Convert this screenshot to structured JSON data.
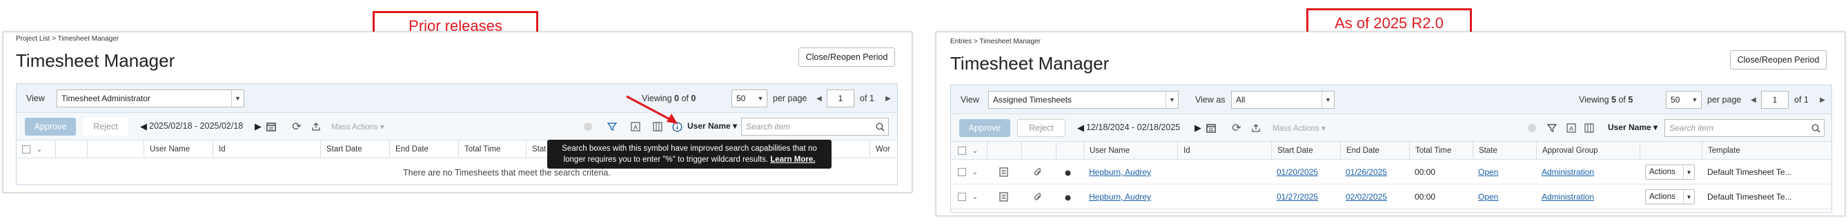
{
  "callouts": {
    "prior": "Prior releases",
    "current": "As of 2025 R2.0"
  },
  "left": {
    "breadcrumb": "Project List > Timesheet Manager",
    "title": "Timesheet Manager",
    "close_reopen": "Close/Reopen Period",
    "view_label": "View",
    "view_value": "Timesheet Administrator",
    "viewing_prefix": "Viewing",
    "viewing_count": "0",
    "viewing_of": "of",
    "viewing_total": "0",
    "per_page_value": "50",
    "per_page_label": "per page",
    "page_value": "1",
    "page_of": "of 1",
    "approve": "Approve",
    "reject": "Reject",
    "date_range": "2025/02/18 - 2025/02/18",
    "mass_actions": "Mass Actions",
    "search_field": "User Name",
    "search_placeholder": "Search item",
    "columns": [
      "User Name",
      "Id",
      "Start Date",
      "End Date",
      "Total Time",
      "Stat",
      "Wor"
    ],
    "tooltip": {
      "line1": "Search boxes with this symbol have improved search capabilities that no",
      "line2": "longer requires you to enter \"%\" to trigger wildcard results.",
      "learn_more": "Learn More."
    },
    "empty_message": "There are no Timesheets that meet the search criteria."
  },
  "right": {
    "breadcrumb": "Entries > Timesheet Manager",
    "title": "Timesheet Manager",
    "close_reopen": "Close/Reopen Period",
    "view_label": "View",
    "view_value": "Assigned Timesheets",
    "view_as_label": "View as",
    "view_as_value": "All",
    "viewing_prefix": "Viewing",
    "viewing_count": "5",
    "viewing_of": "of",
    "viewing_total": "5",
    "per_page_value": "50",
    "per_page_label": "per page",
    "page_value": "1",
    "page_of": "of 1",
    "approve": "Approve",
    "reject": "Reject",
    "date_range": "12/18/2024 - 02/18/2025",
    "mass_actions": "Mass Actions",
    "search_field": "User Name",
    "search_placeholder": "Search item",
    "columns": [
      "User Name",
      "Id",
      "Start Date",
      "End Date",
      "Total Time",
      "State",
      "Approval Group",
      "Template"
    ],
    "rows": [
      {
        "user": "Hepburn, Audrey",
        "start": "01/20/2025",
        "end": "01/26/2025",
        "total": "00:00",
        "state": "Open",
        "group": "Administration",
        "actions": "Actions",
        "template": "Default Timesheet Te..."
      },
      {
        "user": "Hepburn, Audrey",
        "start": "01/27/2025",
        "end": "02/02/2025",
        "total": "00:00",
        "state": "Open",
        "group": "Administration",
        "actions": "Actions",
        "template": "Default Timesheet Te..."
      }
    ]
  },
  "colors": {
    "callout_red": "#e0191e",
    "link_blue": "#1a5fa8",
    "approve_disabled": "#a9c5dc",
    "arrow_red": "#e0191e"
  }
}
